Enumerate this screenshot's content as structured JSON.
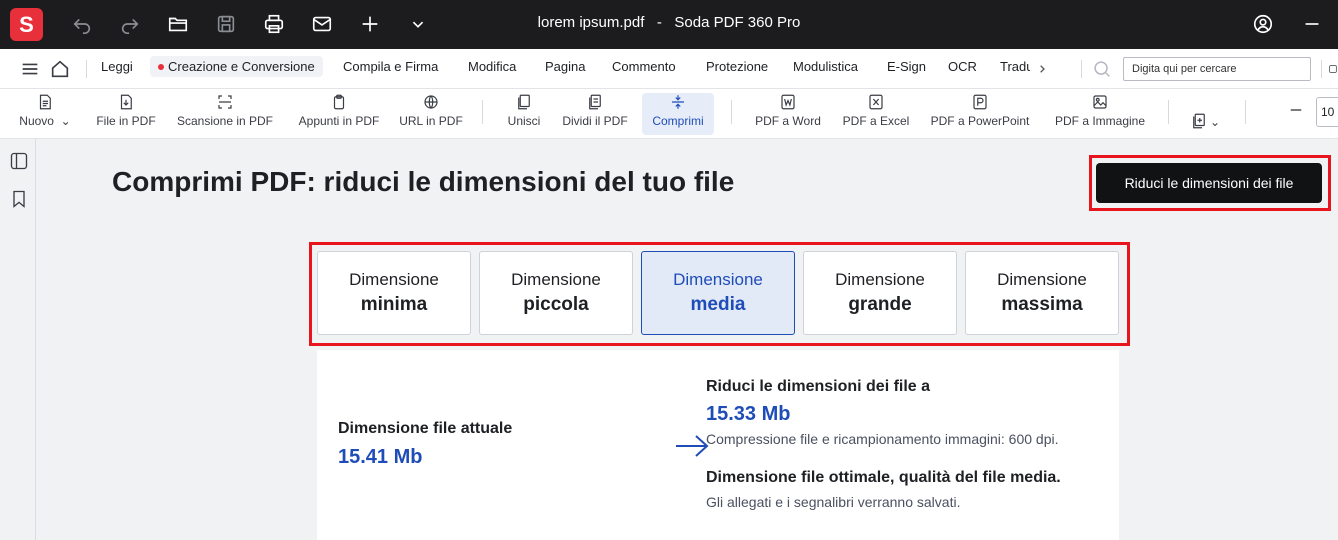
{
  "app": {
    "logo_letter": "S",
    "file_name": "lorem ipsum.pdf",
    "separator": "-",
    "app_name": "Soda PDF 360 Pro"
  },
  "titlebar_icons": [
    "undo-icon",
    "redo-icon",
    "open-folder-icon",
    "save-icon",
    "print-icon",
    "mail-icon",
    "plus-icon",
    "chevron-down-icon",
    "account-icon",
    "minimize-icon"
  ],
  "menu": {
    "items": [
      "Leggi",
      "Creazione e Conversione",
      "Compila e Firma",
      "Modifica",
      "Pagina",
      "Commento",
      "Protezione",
      "Modulistica",
      "E-Sign",
      "OCR",
      "Tradu"
    ],
    "active": "Creazione e Conversione",
    "search_placeholder": "Digita qui per cercare"
  },
  "toolbar": {
    "items": [
      "Nuovo",
      "File in PDF",
      "Scansione in PDF",
      "Appunti in PDF",
      "URL in PDF",
      "Unisci",
      "Dividi il PDF",
      "Comprimi",
      "PDF a Word",
      "PDF a Excel",
      "PDF a PowerPoint",
      "PDF a Immagine"
    ],
    "active": "Comprimi",
    "zoom_value": "10"
  },
  "main": {
    "title": "Comprimi PDF: riduci le dimensioni del tuo file",
    "cta": "Riduci le dimensioni dei file",
    "options": [
      {
        "line1": "Dimensione",
        "line2": "minima"
      },
      {
        "line1": "Dimensione",
        "line2": "piccola"
      },
      {
        "line1": "Dimensione",
        "line2": "media"
      },
      {
        "line1": "Dimensione",
        "line2": "grande"
      },
      {
        "line1": "Dimensione",
        "line2": "massima"
      }
    ],
    "selected_option": "media",
    "current_label": "Dimensione file attuale",
    "current_value": "15.41 Mb",
    "target_label": "Riduci le dimensioni dei file a",
    "target_value": "15.33 Mb",
    "target_note": "Compressione file e ricampionamento immagini: 600 dpi.",
    "optimal_title": "Dimensione file ottimale, qualità del file media.",
    "optimal_note": "Gli allegati e i segnalibri verranno salvati."
  },
  "colors": {
    "accent_blue": "#1f4db8",
    "brand_red": "#e8303a",
    "highlight_red": "#e8141e"
  }
}
